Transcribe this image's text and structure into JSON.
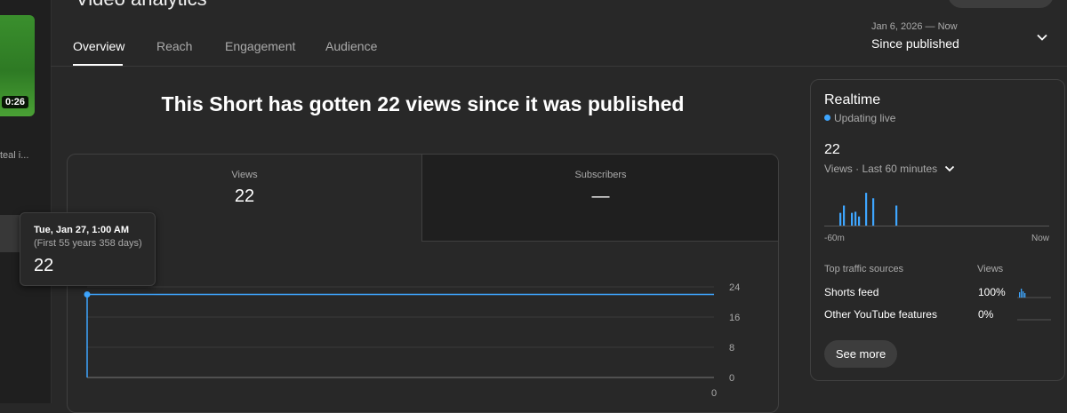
{
  "header": {
    "page_title": "Video analytics",
    "tabs": [
      "Overview",
      "Reach",
      "Engagement",
      "Audience"
    ],
    "date_range": {
      "dates": "Jan 6, 2026 — Now",
      "label": "Since published"
    }
  },
  "sidebar": {
    "thumbnail_duration": "0:26",
    "video_title_fragment": "teal i..."
  },
  "headline": "This Short has gotten 22 views since it was published",
  "metrics": [
    {
      "label": "Views",
      "value": "22"
    },
    {
      "label": "Subscribers",
      "value": "—"
    }
  ],
  "tooltip": {
    "date": "Tue, Jan 27, 1:00 AM",
    "sub": "(First 55 years 358 days)",
    "value": "22"
  },
  "chart_data": {
    "type": "line",
    "series": [
      {
        "values": [
          22,
          22
        ]
      }
    ],
    "x": [
      "",
      ""
    ],
    "ylim": [
      0,
      24
    ],
    "yticks": [
      "0",
      "8",
      "16",
      "24"
    ],
    "grid": true,
    "color": "#3ea6ff"
  },
  "realtime": {
    "title": "Realtime",
    "status": "Updating live",
    "count": "22",
    "metric_label": "Views · Last 60 minutes",
    "axis_left": "-60m",
    "axis_right": "Now",
    "bars": [
      0.35,
      0.55,
      0.35,
      0.38,
      0.25,
      0.9,
      0.75,
      0.55
    ],
    "traffic_header": {
      "source": "Top traffic sources",
      "metric": "Views"
    },
    "traffic": [
      {
        "name": "Shorts feed",
        "pct": "100%"
      },
      {
        "name": "Other YouTube features",
        "pct": "0%"
      }
    ],
    "see_more": "See more",
    "accent": "#3ea6ff"
  }
}
